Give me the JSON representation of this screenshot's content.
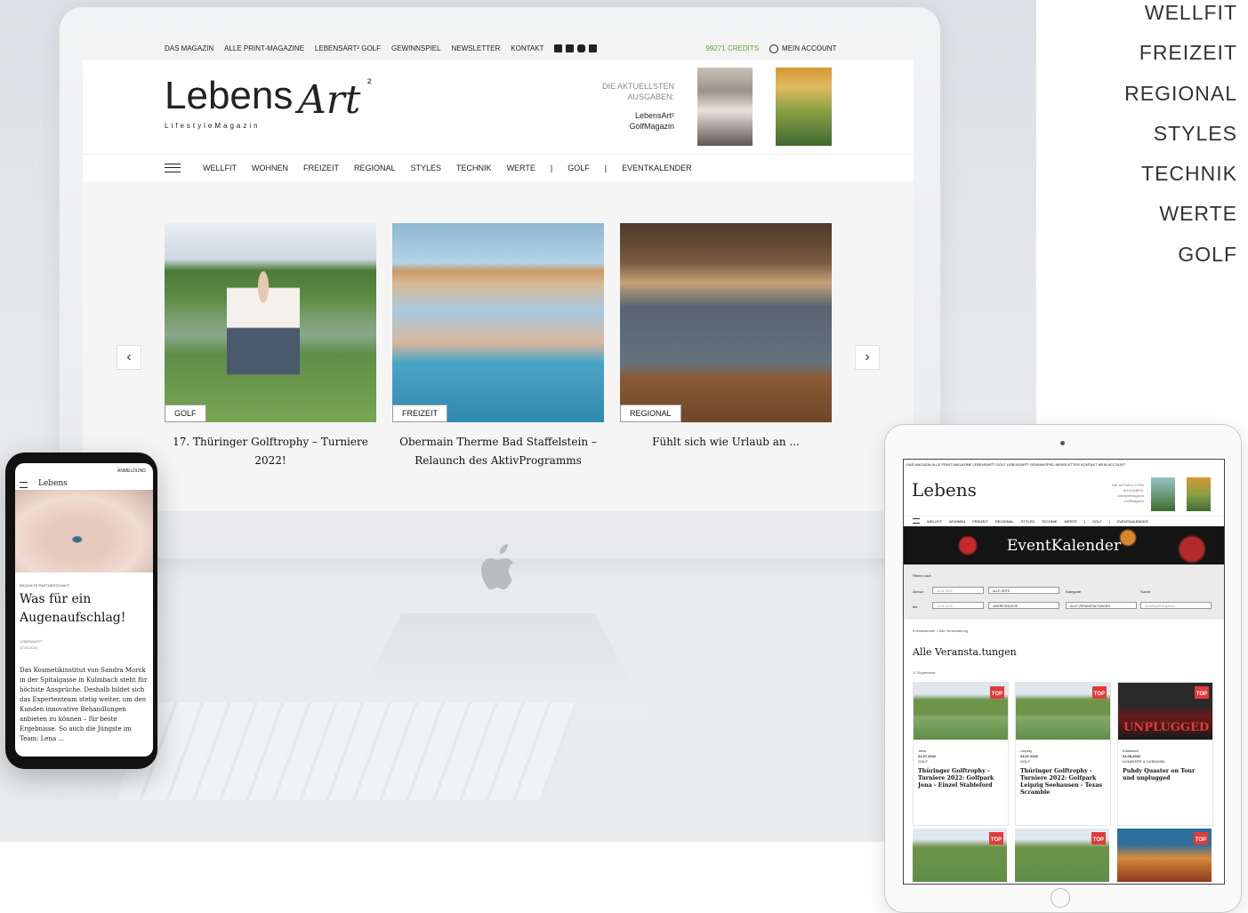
{
  "side_menu": [
    "WELLFIT",
    "FREIZEIT",
    "REGIONAL",
    "STYLES",
    "TECHNIK",
    "WERTE",
    "GOLF"
  ],
  "topbar": {
    "links": [
      "DAS MAGAZIN",
      "ALLE PRINT-MAGAZINE",
      "LEBENSART² GOLF",
      "GEWINNSPIEL",
      "NEWSLETTER",
      "KONTAKT"
    ],
    "social_icons": [
      "facebook-icon",
      "pinterest-icon",
      "instagram-icon",
      "mail-icon"
    ],
    "credits": "99271 CREDITS",
    "account": "MEIN ACCOUNT"
  },
  "header": {
    "logo_main": "Lebens",
    "logo_script": "Art",
    "logo_sup": "²",
    "logo_sub": "LifestyleMagazin",
    "issues_label_1": "DIE AKTUELLSTEN",
    "issues_label_2": "AUSGABEN:",
    "issue_1": "LebensArt²",
    "issue_2": "GolfMagazin"
  },
  "nav": [
    "WELLFIT",
    "WOHNEN",
    "FREIZEIT",
    "REGIONAL",
    "STYLES",
    "TECHNIK",
    "WERTE",
    "|",
    "GOLF",
    "|",
    "EVENTKALENDER"
  ],
  "cards": [
    {
      "tag": "GOLF",
      "title_1": "17. Thüringer Golftrophy – Turniere",
      "title_2": "2022!"
    },
    {
      "tag": "FREIZEIT",
      "title_1": "Obermain Therme Bad Staffelstein –",
      "title_2": "Relaunch des AktivProgramms"
    },
    {
      "tag": "REGIONAL",
      "title_1": "Fühlt sich wie Urlaub an ...",
      "title_2": ""
    }
  ],
  "carousel": {
    "prev": "‹",
    "next": "›"
  },
  "phone": {
    "top_label": "ANMELDUNG",
    "logo": "Lebens",
    "sponsor": "BEZAHLTE PARTNERSCHAFT",
    "headline_1": "Was für ein",
    "headline_2": "Augenaufschlag!",
    "author": "LEBENSART²",
    "date": "22.02.2022",
    "body": "Das Kosmetikinstitut von Sandra Morck in der Spitalgasse in Kulmbach steht für höchste Ansprüche. Deshalb bildet sich das Expertenteam stetig weiter, um den Kunden innovative Behandlungen anbieten zu können – für beste Ergebnisse. So auch die Jüngste im Team: Lena ..."
  },
  "tablet": {
    "topbar": "DAS MAGAZIN  ALLE PRINT-MAGAZINE  LEBENSART² GOLF  LEBENSART² GEWINNSPIEL  NEWSLETTER  KONTAKT  MEIN ACCOUNT",
    "logo": "Lebens",
    "issues": "DIE AKTUELLSTEN AUSGABEN: LifestyleMagazin GolfMagazin",
    "nav": [
      "WELLFIT",
      "WOHNEN",
      "FREIZEIT",
      "REGIONAL",
      "STYLES",
      "TECHNIK",
      "WERTE",
      "|",
      "GOLF",
      "|",
      "EVENTKALENDER"
    ],
    "banner": "EventKalender",
    "filter_title": "Filtern nach",
    "label_from": "Ab/von",
    "label_to": "bis",
    "date_from": "16.01.2022",
    "date_to": "16.01.2023",
    "select_place": "ALLE ORTE",
    "select_radius": "UMKREISSUCHE",
    "label_category": "Kategorie",
    "select_category": "ALLE VERANSTALTUNGEN",
    "label_search": "Suche",
    "search_placeholder": "Suchbegriff eingeben...",
    "breadcrumb": "Eventkalender » Alle Veranstaltung",
    "heading": "Alle Veransta.tungen",
    "count": "17 Ergebnisse",
    "events": [
      {
        "top": "TOP",
        "place": "Jena",
        "date": "31.07.2022",
        "category": "GOLF",
        "title": "Thüringer Golftrophy - Turniere 2022: Golfpark Jena - Einzel Stableford"
      },
      {
        "top": "TOP",
        "place": "Leipzig",
        "date": "24.07.2022",
        "category": "GOLF",
        "title": "Thüringer Golftrophy - Turniere 2022: Golfpark Leipzig Seehausen - Texas Scramble"
      },
      {
        "top": "TOP",
        "place": "Kulmbach",
        "date": "01.08.2022",
        "category": "KONZERTE & LIVEMUSIK",
        "title": "Puhdy Quaster on Tour und unplugged",
        "image_text": "UNPLUGGED"
      }
    ],
    "events_row2": [
      "TOP",
      "TOP",
      "TOP"
    ]
  }
}
